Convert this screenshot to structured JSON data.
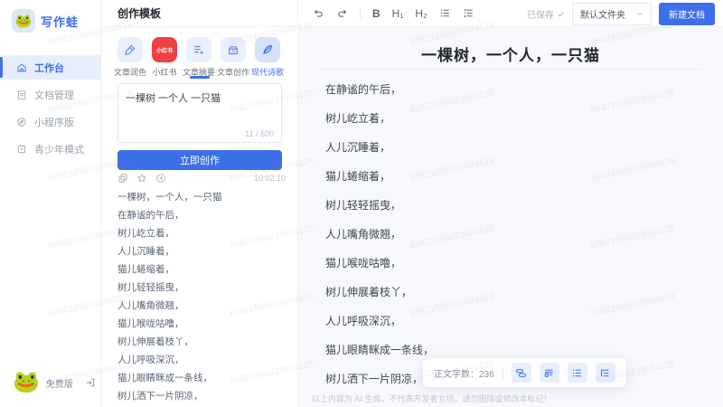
{
  "app": {
    "name": "写作蛙",
    "version_label": "免费版"
  },
  "sidebar": {
    "items": [
      {
        "label": "工作台"
      },
      {
        "label": "文档管理"
      },
      {
        "label": "小程序版"
      },
      {
        "label": "青少年模式"
      }
    ]
  },
  "panel": {
    "title": "创作模板",
    "tabs": [
      {
        "label": "文章润色"
      },
      {
        "label": "小红书",
        "badge": "小红书"
      },
      {
        "label": "文章摘要"
      },
      {
        "label": "文章创作"
      },
      {
        "label": "现代诗歌"
      }
    ],
    "input": {
      "value": "一棵树 一个人 一只猫",
      "count": "11 / 500"
    },
    "create_button": "立即创作",
    "output": {
      "timestamp": "10:02:10",
      "lines": [
        "一棵树，一个人，一只猫",
        "在静谧的午后，",
        "树儿屹立着，",
        "人儿沉睡着，",
        "猫儿蜷缩着，",
        "树儿轻轻摇曳，",
        "人儿嘴角微翘，",
        "猫儿喉咙咕噜，",
        "树儿伸展着枝丫，",
        "人儿呼吸深沉，",
        "猫儿眼睛眯成一条线，",
        "树儿洒下一片阴凉，"
      ]
    }
  },
  "editor": {
    "toolbar": {
      "bold": "B",
      "h1": "H₁",
      "h2": "H₂"
    },
    "status": {
      "saved": "已保存",
      "folder": "默认文件夹",
      "new_doc": "新建文档"
    },
    "document": {
      "title": "一棵树，一个人，一只猫",
      "lines": [
        "在静谧的午后，",
        "树儿屹立着，",
        "人儿沉睡着，",
        "猫儿蜷缩着，",
        "树儿轻轻摇曳，",
        "人儿嘴角微翘，",
        "猫儿喉咙咕噜，",
        "树儿伸展着枝丫，",
        "人儿呼吸深沉，",
        "猫儿眼睛眯成一条线，",
        "树儿洒下一片阴凉，"
      ]
    },
    "footer": {
      "word_count_label": "正文字数：",
      "word_count_value": "236"
    },
    "disclaimer": "以上内容为 AI 生成，不代表开发者立场，请勿删除或修改本标记！"
  },
  "watermark": {
    "text": "88821696933484128"
  },
  "colors": {
    "primary": "#3d6fe8",
    "xiaohongshu": "#ee4143",
    "editor_bg": "#f7f8fb",
    "active_nav_bg": "#e7eefb"
  }
}
